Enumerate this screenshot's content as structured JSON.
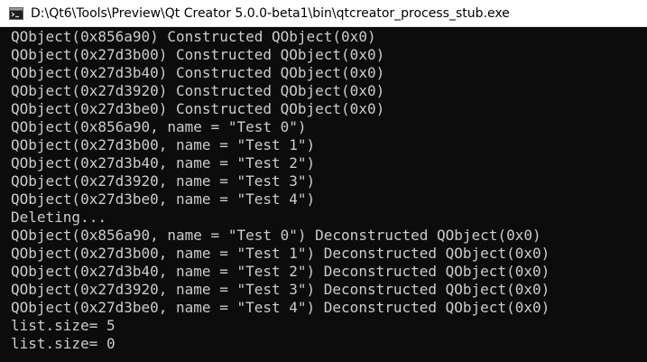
{
  "window": {
    "title": "D:\\Qt6\\Tools\\Preview\\Qt Creator 5.0.0-beta1\\bin\\qtcreator_process_stub.exe",
    "icon": "console-app-icon"
  },
  "console": {
    "lines": [
      "QObject(0x856a90) Constructed QObject(0x0)",
      "QObject(0x27d3b00) Constructed QObject(0x0)",
      "QObject(0x27d3b40) Constructed QObject(0x0)",
      "QObject(0x27d3920) Constructed QObject(0x0)",
      "QObject(0x27d3be0) Constructed QObject(0x0)",
      "QObject(0x856a90, name = \"Test 0\")",
      "QObject(0x27d3b00, name = \"Test 1\")",
      "QObject(0x27d3b40, name = \"Test 2\")",
      "QObject(0x27d3920, name = \"Test 3\")",
      "QObject(0x27d3be0, name = \"Test 4\")",
      "Deleting...",
      "QObject(0x856a90, name = \"Test 0\") Deconstructed QObject(0x0)",
      "QObject(0x27d3b00, name = \"Test 1\") Deconstructed QObject(0x0)",
      "QObject(0x27d3b40, name = \"Test 2\") Deconstructed QObject(0x0)",
      "QObject(0x27d3920, name = \"Test 3\") Deconstructed QObject(0x0)",
      "QObject(0x27d3be0, name = \"Test 4\") Deconstructed QObject(0x0)",
      "list.size= 5",
      "list.size= 0"
    ]
  },
  "colors": {
    "background": "#0c0c0c",
    "text": "#cccccc",
    "titlebar": "#ffffff"
  }
}
